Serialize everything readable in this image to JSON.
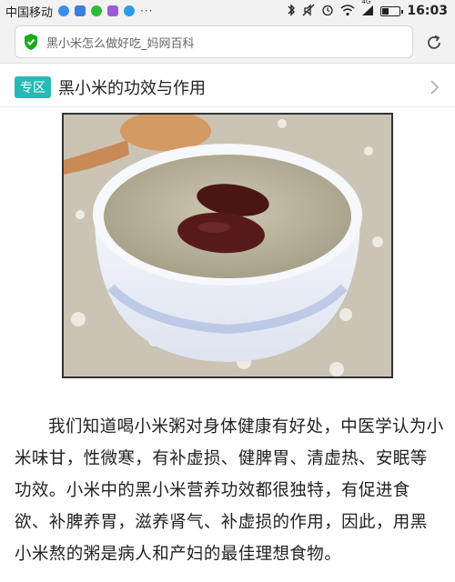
{
  "status_bar": {
    "carrier": "中国移动",
    "dots": "···",
    "network": "4G",
    "time": "16:03"
  },
  "address_bar": {
    "text": "黑小米怎么做好吃_妈网百科"
  },
  "topic": {
    "badge": "专区",
    "title": "黑小米的功效与作用"
  },
  "article": {
    "paragraph": "我们知道喝小米粥对身体健康有好处，中医学认为小米味甘，性微寒，有补虚损、健脾胃、清虚热、安眠等功效。小米中的黑小米营养功效都很独特，有促进食欲、补脾养胃，滋养肾气、补虚损的作用，因此，用黑小米熬的粥是病人和产妇的最佳理想食物。"
  },
  "colors": {
    "accent": "#27b9b5",
    "shield": "#1aad19",
    "status_bg": "#f2f2f2"
  },
  "icons": {
    "shield": "shield-check-icon",
    "reload": "reload-icon",
    "chevron": "chevron-right-icon",
    "bluetooth": "bluetooth-icon",
    "mute": "mute-icon",
    "alarm": "alarm-icon",
    "wifi": "wifi-icon",
    "signal": "signal-icon",
    "battery": "battery-icon"
  }
}
